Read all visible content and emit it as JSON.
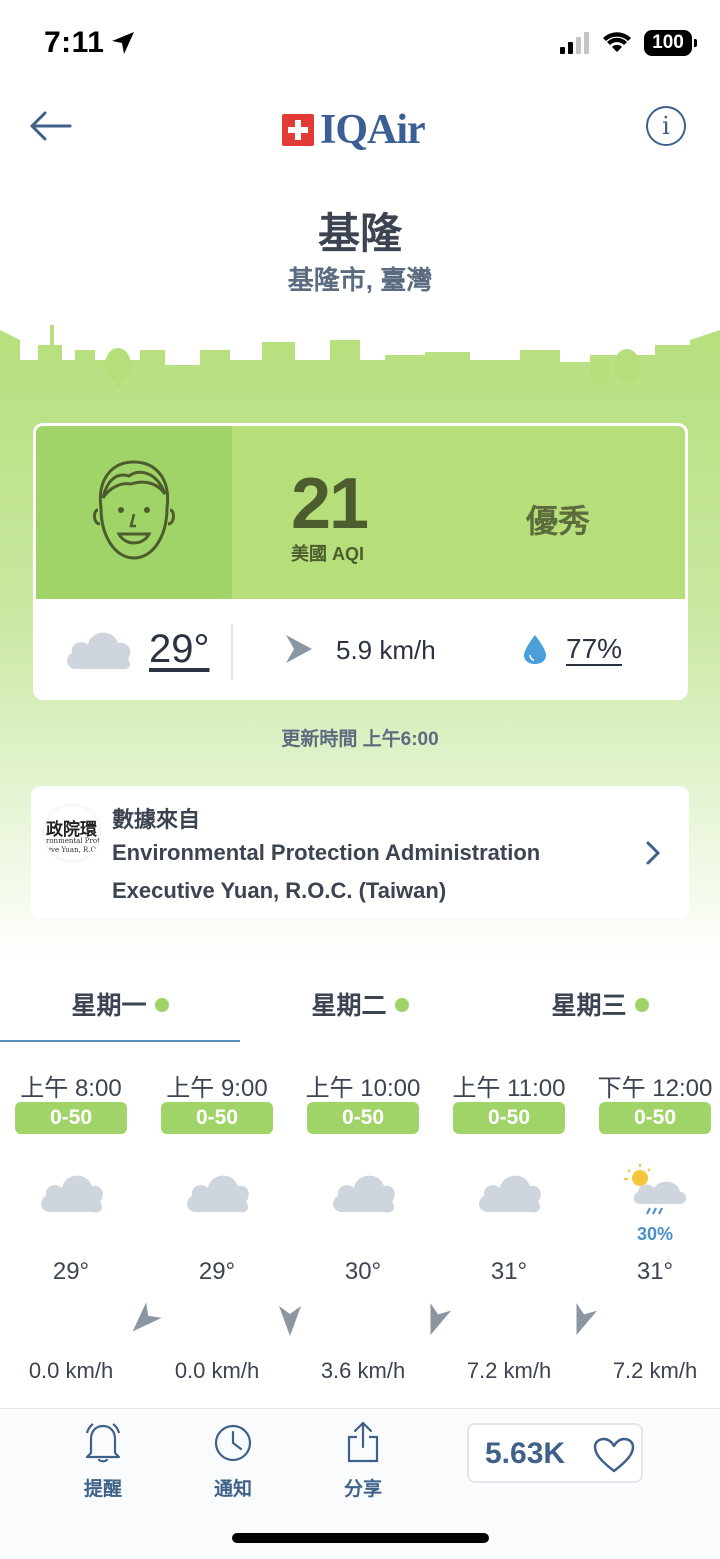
{
  "status_bar": {
    "time": "7:11",
    "battery": "100"
  },
  "header": {
    "back_icon": "back-arrow-icon",
    "logo": "IQAir",
    "info_icon": "info-icon"
  },
  "location": {
    "city": "基隆",
    "region": "基隆市, 臺灣"
  },
  "aqi_card": {
    "aqi_value": "21",
    "aqi_label": "美國 AQI",
    "status": "優秀",
    "status_color": "#b6df7c",
    "temperature": "29°",
    "wind_speed": "5.9 km/h",
    "humidity": "77%"
  },
  "updated": "更新時間 上午6:00",
  "source": {
    "title": "數據來自",
    "name_line1": "Environmental Protection Administration",
    "name_line2": "Executive Yuan, R.O.C. (Taiwan)",
    "logo_big": "政院環",
    "logo_small1": "ronmental Protec",
    "logo_small2": "tive Yuan, R.O."
  },
  "day_tabs": [
    {
      "label": "星期一",
      "active": true
    },
    {
      "label": "星期二",
      "active": false
    },
    {
      "label": "星期三",
      "active": false
    }
  ],
  "hourly": [
    {
      "time": "上午 8:00",
      "aqi_range": "0-50",
      "icon": "cloud-icon",
      "precip": "",
      "temp": "29°",
      "wind_dir_deg": 225,
      "wind": "0.0 km/h"
    },
    {
      "time": "上午 9:00",
      "aqi_range": "0-50",
      "icon": "cloud-icon",
      "precip": "",
      "temp": "29°",
      "wind_dir_deg": 180,
      "wind": "0.0 km/h"
    },
    {
      "time": "上午 10:00",
      "aqi_range": "0-50",
      "icon": "cloud-icon",
      "precip": "",
      "temp": "30°",
      "wind_dir_deg": 200,
      "wind": "3.6 km/h"
    },
    {
      "time": "上午 11:00",
      "aqi_range": "0-50",
      "icon": "cloud-icon",
      "precip": "",
      "temp": "31°",
      "wind_dir_deg": 200,
      "wind": "7.2 km/h"
    },
    {
      "time": "下午 12:00",
      "aqi_range": "0-50",
      "icon": "sun-rain-cloud-icon",
      "precip": "30%",
      "temp": "31°",
      "wind_dir_deg": 200,
      "wind": "7.2 km/h"
    }
  ],
  "bottom_bar": {
    "alert_label": "提醒",
    "notify_label": "通知",
    "share_label": "分享",
    "likes": "5.63K"
  },
  "colors": {
    "aqi_good": "#a1d468",
    "brand_blue": "#3f6189",
    "logo_red": "#e43a35"
  }
}
